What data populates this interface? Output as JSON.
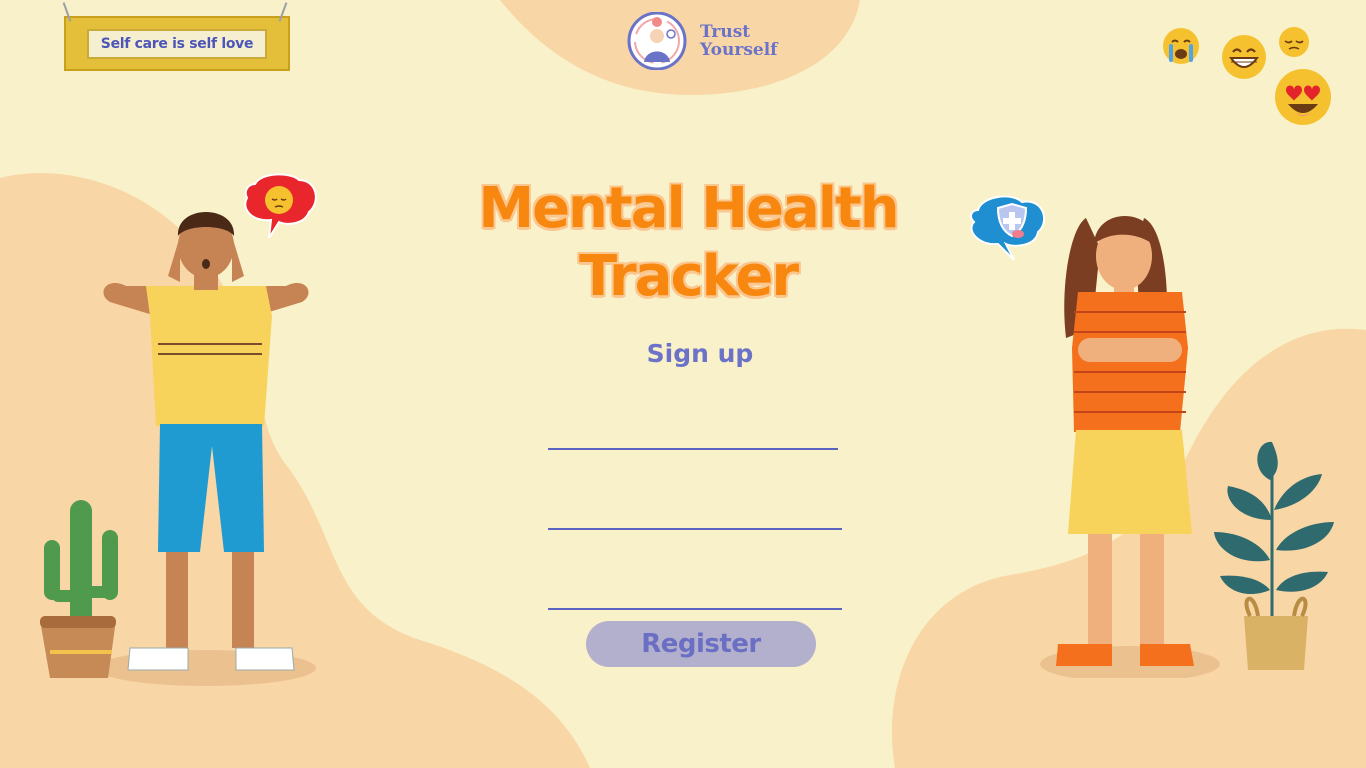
{
  "sign": {
    "text": "Self care is self love"
  },
  "logo": {
    "line1": "Trust",
    "line2": "Yourself"
  },
  "title": {
    "line1": "Mental Health",
    "line2": "Tracker"
  },
  "signup": {
    "heading": "Sign up"
  },
  "fields": [
    {
      "value": "",
      "placeholder": ""
    },
    {
      "value": "",
      "placeholder": ""
    },
    {
      "value": "",
      "placeholder": ""
    }
  ],
  "register": {
    "label": "Register"
  },
  "colors": {
    "background": "#f8f1c9",
    "blob": "#f9d6a6",
    "title": "#f7870f",
    "accent": "#6b72c8",
    "button": "#b3b0cd"
  },
  "icons": [
    "crying-emoji-icon",
    "grinning-emoji-icon",
    "pensive-emoji-icon",
    "heart-eyes-emoji-icon",
    "sad-thought-bubble-icon",
    "health-shield-bubble-icon",
    "cactus-plant-icon",
    "potted-plant-icon"
  ]
}
